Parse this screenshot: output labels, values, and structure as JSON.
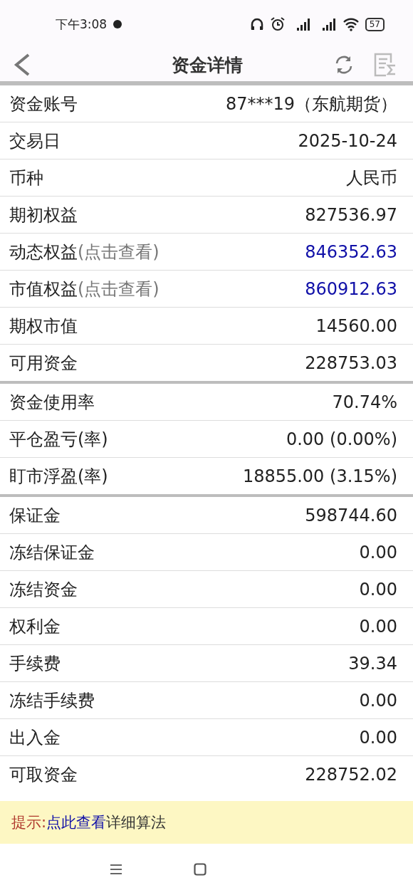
{
  "status_bar": {
    "time": "下午3:08",
    "battery": "57"
  },
  "header": {
    "title": "资金详情"
  },
  "sections": [
    {
      "rows": [
        {
          "label": "资金账号",
          "value": "87***19（东航期货）",
          "kind": "plain"
        },
        {
          "label": "交易日",
          "value": "2025-10-24",
          "kind": "plain"
        },
        {
          "label": "币种",
          "value": "人民币",
          "kind": "plain"
        },
        {
          "label": "期初权益",
          "value": "827536.97",
          "kind": "plain"
        },
        {
          "label": "动态权益",
          "note": "(点击查看)",
          "value": "846352.63",
          "kind": "link"
        },
        {
          "label": "市值权益",
          "note": "(点击查看)",
          "value": "860912.63",
          "kind": "link"
        },
        {
          "label": "期权市值",
          "value": "14560.00",
          "kind": "plain"
        },
        {
          "label": "可用资金",
          "value": "228753.03",
          "kind": "plain"
        }
      ]
    },
    {
      "rows": [
        {
          "label": "资金使用率",
          "value": "70.74%",
          "kind": "plain"
        },
        {
          "label": "平仓盈亏(率)",
          "value": "0.00 (0.00%)",
          "kind": "plain"
        },
        {
          "label": "盯市浮盈(率)",
          "value": "18855.00 (3.15%)",
          "kind": "plain"
        }
      ]
    },
    {
      "rows": [
        {
          "label": "保证金",
          "value": "598744.60",
          "kind": "plain"
        },
        {
          "label": "冻结保证金",
          "value": "0.00",
          "kind": "plain"
        },
        {
          "label": "冻结资金",
          "value": "0.00",
          "kind": "plain"
        },
        {
          "label": "权利金",
          "value": "0.00",
          "kind": "plain"
        },
        {
          "label": "手续费",
          "value": "39.34",
          "kind": "plain"
        },
        {
          "label": "冻结手续费",
          "value": "0.00",
          "kind": "plain"
        },
        {
          "label": "出入金",
          "value": "0.00",
          "kind": "plain"
        },
        {
          "label": "可取资金",
          "value": "228752.02",
          "kind": "plain"
        }
      ]
    }
  ],
  "hint": {
    "prefix": "提示:",
    "link": "点此查看",
    "text": "详细算法"
  }
}
